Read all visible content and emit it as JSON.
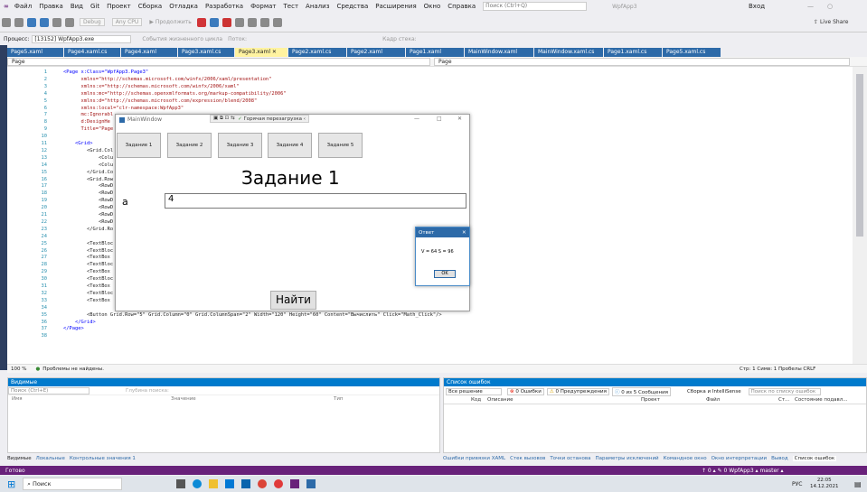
{
  "menu": {
    "items": [
      "Файл",
      "Правка",
      "Вид",
      "Git",
      "Проект",
      "Сборка",
      "Отладка",
      "Разработка",
      "Формат",
      "Тест",
      "Анализ",
      "Средства",
      "Расширения",
      "Окно",
      "Справка"
    ],
    "search_placeholder": "Поиск (Ctrl+Q)",
    "project_name": "WpfApp3",
    "login": "Вход"
  },
  "toolbar": {
    "config": "Debug",
    "platform": "Any CPU",
    "start": "Продолжить",
    "live_share": "Live Share"
  },
  "procbar": {
    "label": "Процесс:",
    "process": "[13152] WpfApp3.exe",
    "lifecycle": "События жизненного цикла",
    "thread": "Поток:",
    "stack": "Кадр стека:"
  },
  "tabs": [
    "Page5.xaml",
    "Page4.xaml.cs",
    "Page4.xaml",
    "Page3.xaml.cs",
    "Page3.xaml",
    "Page2.xaml.cs",
    "Page2.xaml",
    "Page1.xaml",
    "MainWindow.xaml",
    "MainWindow.xaml.cs",
    "Page1.xaml.cs",
    "Page5.xaml.cs"
  ],
  "editor": {
    "left_dropdown": "Page",
    "right_dropdown": "Page",
    "lines": [
      {
        "n": "1",
        "t": "<Page x:Class=\"WpfApp3.Page3\""
      },
      {
        "n": "2",
        "t": "      xmlns=\"http://schemas.microsoft.com/winfx/2006/xaml/presentation\""
      },
      {
        "n": "3",
        "t": "      xmlns:x=\"http://schemas.microsoft.com/winfx/2006/xaml\""
      },
      {
        "n": "4",
        "t": "      xmlns:mc=\"http://schemas.openxmlformats.org/markup-compatibility/2006\""
      },
      {
        "n": "5",
        "t": "      xmlns:d=\"http://schemas.microsoft.com/expression/blend/2008\""
      },
      {
        "n": "6",
        "t": "      xmlns:local=\"clr-namespace:WpfApp3\""
      },
      {
        "n": "7",
        "t": "      mc:Ignorabl"
      },
      {
        "n": "8",
        "t": "      d:DesignHe"
      },
      {
        "n": "9",
        "t": "      Title=\"Page"
      },
      {
        "n": "10",
        "t": ""
      },
      {
        "n": "11",
        "t": "    <Grid>"
      },
      {
        "n": "12",
        "t": "        <Grid.Col"
      },
      {
        "n": "13",
        "t": "            <Colu"
      },
      {
        "n": "14",
        "t": "            <Colu"
      },
      {
        "n": "15",
        "t": "        </Grid.Co"
      },
      {
        "n": "16",
        "t": "        <Grid.Row"
      },
      {
        "n": "17",
        "t": "            <RowD"
      },
      {
        "n": "18",
        "t": "            <RowD"
      },
      {
        "n": "19",
        "t": "            <RowD"
      },
      {
        "n": "20",
        "t": "            <RowD"
      },
      {
        "n": "21",
        "t": "            <RowD"
      },
      {
        "n": "22",
        "t": "            <RowD"
      },
      {
        "n": "23",
        "t": "        </Grid.Ro"
      },
      {
        "n": "24",
        "t": ""
      },
      {
        "n": "25",
        "t": "        <TextBloc"
      },
      {
        "n": "26",
        "t": "        <TextBloc"
      },
      {
        "n": "27",
        "t": "        <TextBox"
      },
      {
        "n": "28",
        "t": "        <TextBloc"
      },
      {
        "n": "29",
        "t": "        <TextBox"
      },
      {
        "n": "30",
        "t": "        <TextBloc"
      },
      {
        "n": "31",
        "t": "        <TextBox"
      },
      {
        "n": "32",
        "t": "        <TextBloc"
      },
      {
        "n": "33",
        "t": "        <TextBox"
      },
      {
        "n": "34",
        "t": ""
      },
      {
        "n": "35",
        "t": "        <Button Grid.Row=\"5\" Grid.Column=\"0\" Grid.ColumnSpan=\"2\" Width=\"120\" Height=\"60\" Content=\"Вычислить\" Click=\"Math_Click\"/>"
      },
      {
        "n": "36",
        "t": "    </Grid>"
      },
      {
        "n": "37",
        "t": "</Page>"
      },
      {
        "n": "38",
        "t": ""
      }
    ]
  },
  "statusline": {
    "zoom": "100 %",
    "problems": "Проблемы не найдены.",
    "position": "Стр: 1   Симв: 1   Пробелы   CRLF"
  },
  "panel_left": {
    "title": "Видимые",
    "search": "Поиск (Ctrl+E)",
    "depth": "Глубина поиска:",
    "cols": [
      "Имя",
      "Значение",
      "Тип"
    ],
    "tabs": [
      "Видимые",
      "Локальные",
      "Контрольные значения 1"
    ]
  },
  "panel_right": {
    "title": "Список ошибок",
    "scope": "Все решение",
    "errors": "0 Ошибки",
    "warnings": "0 Предупреждения",
    "messages": "0 из 5 Сообщения",
    "build": "Сборка и IntelliSense",
    "search": "Поиск по списку ошибок",
    "cols": [
      "Код",
      "Описание",
      "Проект",
      "Файл",
      "Ст...",
      "Состояние подавл..."
    ],
    "tabs": [
      "Ошибки привязки XAML",
      "Стек вызовов",
      "Точки останова",
      "Параметры исключений",
      "Командное окно",
      "Окно интерпретации",
      "Вывод",
      "Список ошибок"
    ]
  },
  "vsstatus": {
    "ready": "Готово",
    "right": "↑ 0 ▴   ✎ 0   WpfApp3 ▴   master ▴"
  },
  "taskbar": {
    "search": "Поиск",
    "lang": "РУС",
    "time": "22:05",
    "date": "14.12.2021"
  },
  "wpf": {
    "title": "MainWindow",
    "hot_reload": "Горячая перезагрузка",
    "buttons": [
      "Задание 1",
      "Задание 2",
      "Задание 3",
      "Задание 4",
      "Задание 5"
    ],
    "heading": "Задание 1",
    "label_a": "a",
    "input_value": "4",
    "find_button": "Найти"
  },
  "dialog": {
    "title": "Ответ",
    "message": "V = 64 S = 96",
    "ok": "OK"
  },
  "colors": {
    "accent": "#007acc",
    "vs_purple": "#68217a",
    "tab_blue": "#2d6aa8",
    "active_tab": "#fff3a0"
  }
}
